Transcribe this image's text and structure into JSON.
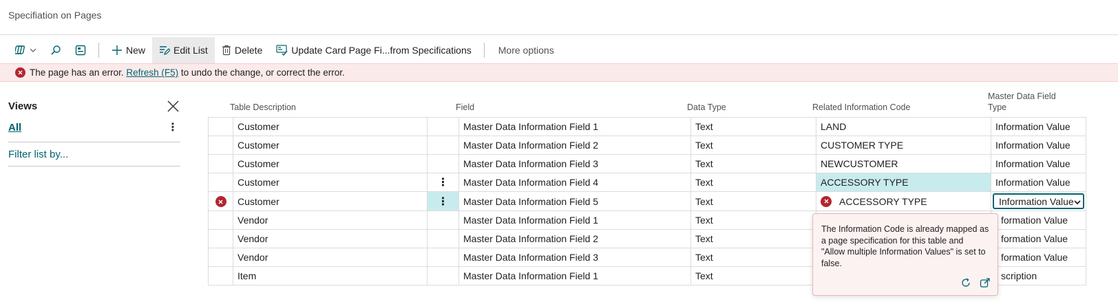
{
  "page": {
    "title": "Specifiation on Pages"
  },
  "toolbar": {
    "new_label": "New",
    "edit_list_label": "Edit List",
    "delete_label": "Delete",
    "update_label": "Update Card Page Fi...from Specifications",
    "more_label": "More options"
  },
  "error_bar": {
    "text_before": "The page has an error.",
    "link_text": "Refresh (F5)",
    "text_after": "to undo the change, or correct the error."
  },
  "views": {
    "title": "Views",
    "all_label": "All",
    "filter_label": "Filter list by..."
  },
  "columns": {
    "table_description": "Table Description",
    "field": "Field",
    "data_type": "Data Type",
    "related_code": "Related Information Code",
    "master_type": "Master Data Field Type"
  },
  "rows": [
    {
      "table": "Customer",
      "field": "Master Data Information Field 1",
      "type": "Text",
      "code": "LAND",
      "master": "Information Value"
    },
    {
      "table": "Customer",
      "field": "Master Data Information Field 2",
      "type": "Text",
      "code": "CUSTOMER TYPE",
      "master": "Information Value"
    },
    {
      "table": "Customer",
      "field": "Master Data Information Field 3",
      "type": "Text",
      "code": "NEWCUSTOMER",
      "master": "Information Value"
    },
    {
      "table": "Customer",
      "field": "Master Data Information Field 4",
      "type": "Text",
      "code": "ACCESSORY TYPE",
      "master": "Information Value"
    },
    {
      "table": "Customer",
      "field": "Master Data Information Field 5",
      "type": "Text",
      "code": "ACCESSORY TYPE",
      "master": "Information Value"
    },
    {
      "table": "Vendor",
      "field": "Master Data Information Field 1",
      "type": "Text",
      "code": "",
      "master": "formation Value"
    },
    {
      "table": "Vendor",
      "field": "Master Data Information Field 2",
      "type": "Text",
      "code": "",
      "master": "formation Value"
    },
    {
      "table": "Vendor",
      "field": "Master Data Information Field 3",
      "type": "Text",
      "code": "",
      "master": "formation Value"
    },
    {
      "table": "Item",
      "field": "Master Data Information Field 1",
      "type": "Text",
      "code": "",
      "master": "scription"
    }
  ],
  "tooltip": {
    "message": "The Information Code is already mapped as a page specification for this table and \"Allow multiple Information Values\" is set to false."
  },
  "colors": {
    "accent": "#00646e",
    "error": "#b3262f",
    "highlight": "#c8ebee",
    "error_bg": "#fbeaea"
  }
}
